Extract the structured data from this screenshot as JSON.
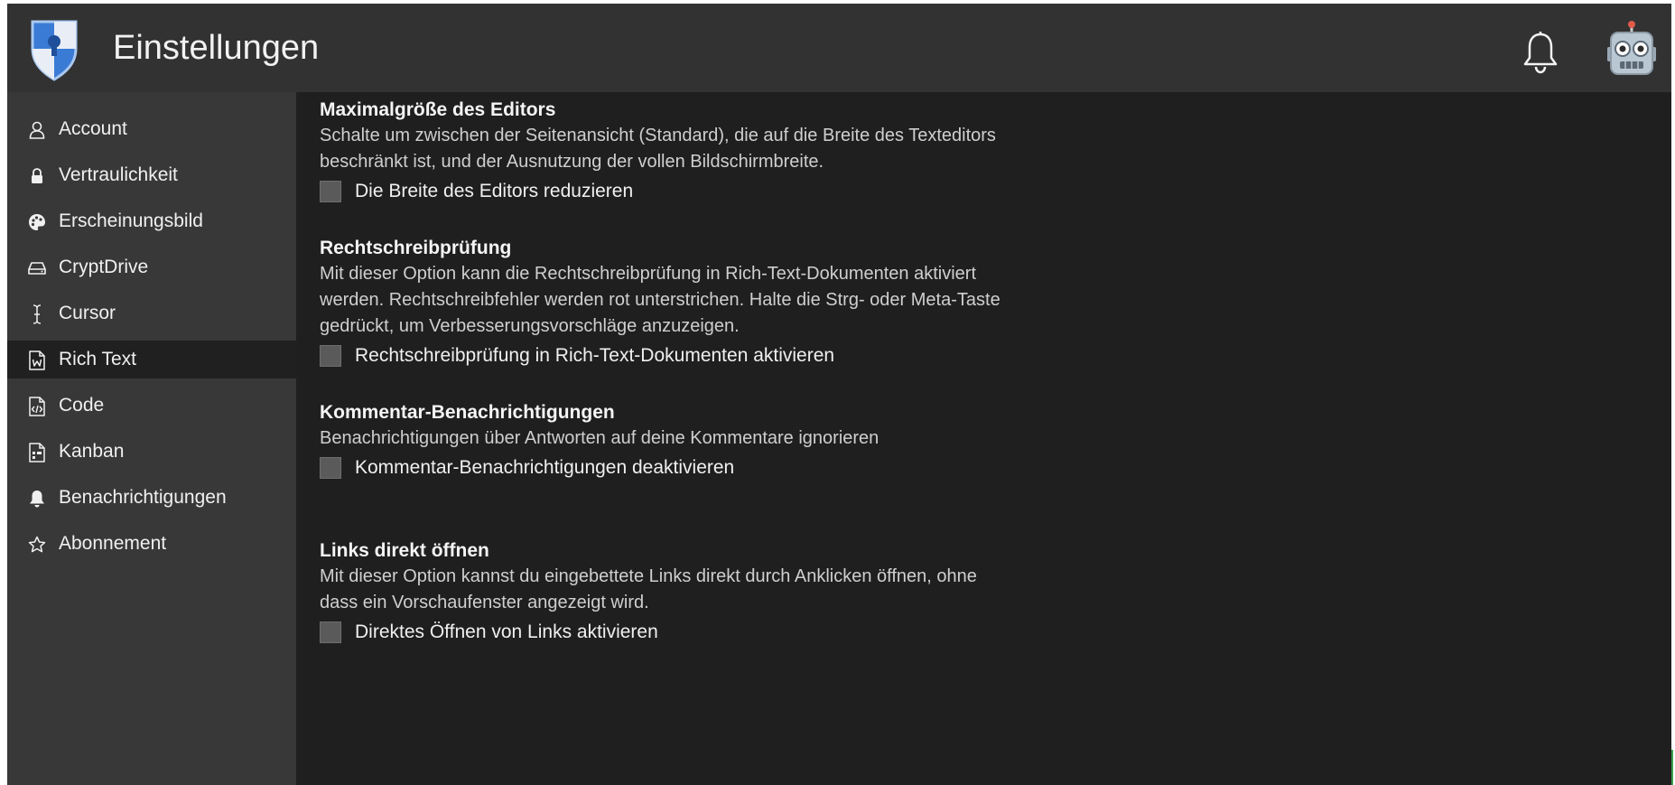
{
  "header": {
    "title": "Einstellungen",
    "logo_icon": "cryptpad-shield-logo",
    "notifications_icon": "bell-icon",
    "avatar_icon": "robot-avatar"
  },
  "sidebar": {
    "active": "Rich Text",
    "items": [
      {
        "label": "Account",
        "icon": "user-icon"
      },
      {
        "label": "Vertraulichkeit",
        "icon": "lock-icon"
      },
      {
        "label": "Erscheinungsbild",
        "icon": "palette-icon"
      },
      {
        "label": "CryptDrive",
        "icon": "drive-icon"
      },
      {
        "label": "Cursor",
        "icon": "text-cursor-icon"
      },
      {
        "label": "Rich Text",
        "icon": "word-document-icon"
      },
      {
        "label": "Code",
        "icon": "code-document-icon"
      },
      {
        "label": "Kanban",
        "icon": "kanban-document-icon"
      },
      {
        "label": "Benachrichtigungen",
        "icon": "bell-icon"
      },
      {
        "label": "Abonnement",
        "icon": "star-icon"
      }
    ]
  },
  "sections": [
    {
      "title": "Maximalgröße des Editors",
      "description": [
        "Schalte um zwischen der Seitenansicht (Standard), die auf die Breite des Texteditors",
        "beschränkt ist, und der Ausnutzung der vollen Bildschirmbreite."
      ],
      "checkbox_label": "Die Breite des Editors reduzieren",
      "checked": false
    },
    {
      "title": "Rechtschreibprüfung",
      "description": [
        "Mit dieser Option kann die Rechtschreibprüfung in Rich-Text-Dokumenten aktiviert",
        "werden. Rechtschreibfehler werden rot unterstrichen. Halte die Strg- oder Meta-Taste",
        "gedrückt, um Verbesserungsvorschläge anzuzeigen."
      ],
      "checkbox_label": "Rechtschreibprüfung in Rich-Text-Dokumenten aktivieren",
      "checked": false
    },
    {
      "title": "Kommentar-Benachrichtigungen",
      "description": [
        "Benachrichtigungen über Antworten auf deine Kommentare ignorieren"
      ],
      "checkbox_label": "Kommentar-Benachrichtigungen deaktivieren",
      "checked": false
    },
    {
      "title": "Links direkt öffnen",
      "description": [
        "Mit dieser Option kannst du eingebettete Links direkt durch Anklicken öffnen, ohne",
        "dass ein Vorschaufenster angezeigt wird."
      ],
      "checkbox_label": "Direktes Öffnen von Links aktivieren",
      "checked": false
    }
  ],
  "colors": {
    "header_bg": "#323232",
    "sidebar_bg": "#383838",
    "content_bg": "#1f1f1f",
    "active_item_bg": "#202020",
    "logo_blue": "#2f6fd1"
  }
}
